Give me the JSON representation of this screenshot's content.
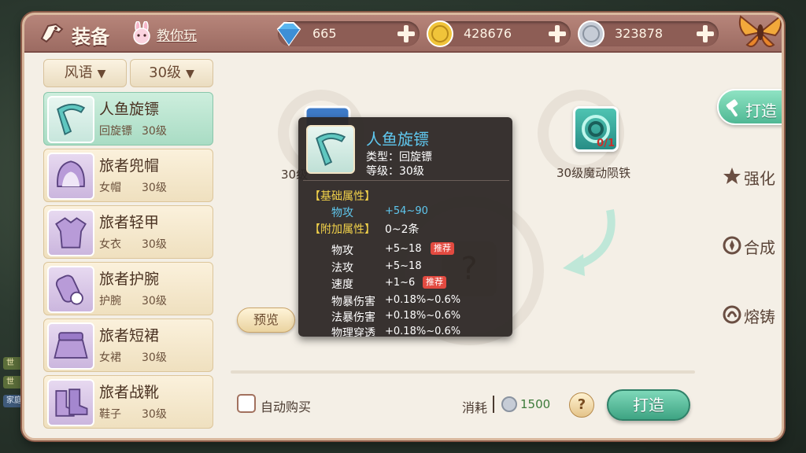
{
  "background": {
    "chat_tags": [
      "世",
      "世",
      "家庭"
    ]
  },
  "header": {
    "title": "装备",
    "tutorial": "教你玩",
    "currencies": [
      {
        "name": "diamond",
        "value": "665",
        "color": "#5ab6f0"
      },
      {
        "name": "gold",
        "value": "428676",
        "color": "#f0c43a"
      },
      {
        "name": "silver",
        "value": "323878",
        "color": "#c6ccd6"
      }
    ]
  },
  "filters": {
    "element": "风语",
    "level": "30级",
    "arrow": "▼"
  },
  "equipment": [
    {
      "name": "人鱼旋镖",
      "type": "回旋镖",
      "level": "30级",
      "selected": true
    },
    {
      "name": "旅者兜帽",
      "type": "女帽",
      "level": "30级",
      "selected": false
    },
    {
      "name": "旅者轻甲",
      "type": "女衣",
      "level": "30级",
      "selected": false
    },
    {
      "name": "旅者护腕",
      "type": "护腕",
      "level": "30级",
      "selected": false
    },
    {
      "name": "旅者短裙",
      "type": "女裙",
      "level": "30级",
      "selected": false
    },
    {
      "name": "旅者战靴",
      "type": "鞋子",
      "level": "30级",
      "selected": false
    }
  ],
  "craft": {
    "material_left_name": "30级",
    "material_right_name": "30级魔动陨铁",
    "material_right_count": "0/1",
    "result_placeholder": "?",
    "preview": "预览"
  },
  "bottom": {
    "auto_buy": "自动购买",
    "cost_label": "消耗",
    "cost_value": "1500",
    "help": "?",
    "forge": "打造"
  },
  "tabs": [
    {
      "label": "打造",
      "icon": "hammer-icon",
      "active": true
    },
    {
      "label": "强化",
      "icon": "star-icon",
      "active": false
    },
    {
      "label": "合成",
      "icon": "combine-icon",
      "active": false
    },
    {
      "label": "熔铸",
      "icon": "smelt-icon",
      "active": false
    }
  ],
  "tooltip": {
    "name": "人鱼旋镖",
    "type_line": "类型：回旋镖",
    "level_line": "等级：30级",
    "base_section": "【基础属性】",
    "base_stat": {
      "name": "物攻",
      "value": "+54~90"
    },
    "extra_section": "【附加属性】",
    "extra_count": "0~2条",
    "extra_stats": [
      {
        "name": "物攻",
        "value": "+5~18",
        "badge": "推荐"
      },
      {
        "name": "法攻",
        "value": "+5~18",
        "badge": ""
      },
      {
        "name": "速度",
        "value": "+1~6",
        "badge": "推荐"
      },
      {
        "name": "物暴伤害",
        "value": "+0.18%~0.6%",
        "badge": ""
      },
      {
        "name": "法暴伤害",
        "value": "+0.18%~0.6%",
        "badge": ""
      },
      {
        "name": "物理穿透",
        "value": "+0.18%~0.6%",
        "badge": ""
      }
    ]
  }
}
